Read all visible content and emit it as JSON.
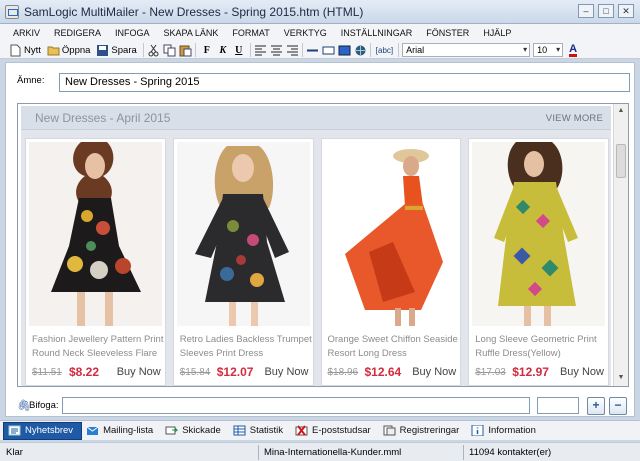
{
  "window": {
    "title": "SamLogic MultiMailer - New Dresses - Spring 2015.htm  (HTML)"
  },
  "menu": [
    "ARKIV",
    "REDIGERA",
    "INFOGA",
    "SKAPA LÄNK",
    "FORMAT",
    "VERKTYG",
    "INSTÄLLNINGAR",
    "FÖNSTER",
    "HJÄLP"
  ],
  "toolbar": {
    "new_label": "Nytt",
    "open_label": "Öppna",
    "save_label": "Spara",
    "bold": "F",
    "italic": "K",
    "underline": "U",
    "code_label": "[abc]",
    "font": "Arial",
    "size": "10",
    "font_color_label": "A",
    "font_color": "#cc1111"
  },
  "subject": {
    "label": "Ämne:",
    "value": "New Dresses - Spring 2015"
  },
  "newsletter": {
    "title": "New Dresses - April 2015",
    "view_more": "VIEW MORE",
    "products": [
      {
        "name": "Fashion Jewellery Pattern Print Round Neck Sleeveless Flare",
        "old_price": "$11.51",
        "price": "$8.22",
        "buy": "Buy Now"
      },
      {
        "name": "Retro Ladies Backless Trumpet Sleeves Print Dress",
        "old_price": "$15.84",
        "price": "$12.07",
        "buy": "Buy Now"
      },
      {
        "name": "Orange Sweet Chiffon Seaside Resort Long Dress",
        "old_price": "$18.96",
        "price": "$12.64",
        "buy": "Buy Now"
      },
      {
        "name": "Long Sleeve Geometric Print Ruffle Dress(Yellow)",
        "old_price": "$17.03",
        "price": "$12.97",
        "buy": "Buy Now"
      }
    ]
  },
  "attachments": {
    "label": "Bifoga:",
    "add": "+",
    "remove": "−"
  },
  "tabs": [
    {
      "label": "Nyhetsbrev",
      "icon": "newsletter-icon"
    },
    {
      "label": "Mailing-lista",
      "icon": "mailing-list-icon"
    },
    {
      "label": "Skickade",
      "icon": "sent-icon"
    },
    {
      "label": "Statistik",
      "icon": "statistics-icon"
    },
    {
      "label": "E-poststudsar",
      "icon": "bounce-icon"
    },
    {
      "label": "Registreringar",
      "icon": "registrations-icon"
    },
    {
      "label": "Information",
      "icon": "information-icon"
    }
  ],
  "status": {
    "state": "Klar",
    "file": "Mina-Internationella-Kunder.mml",
    "contacts": "11094 kontakter(er)"
  }
}
